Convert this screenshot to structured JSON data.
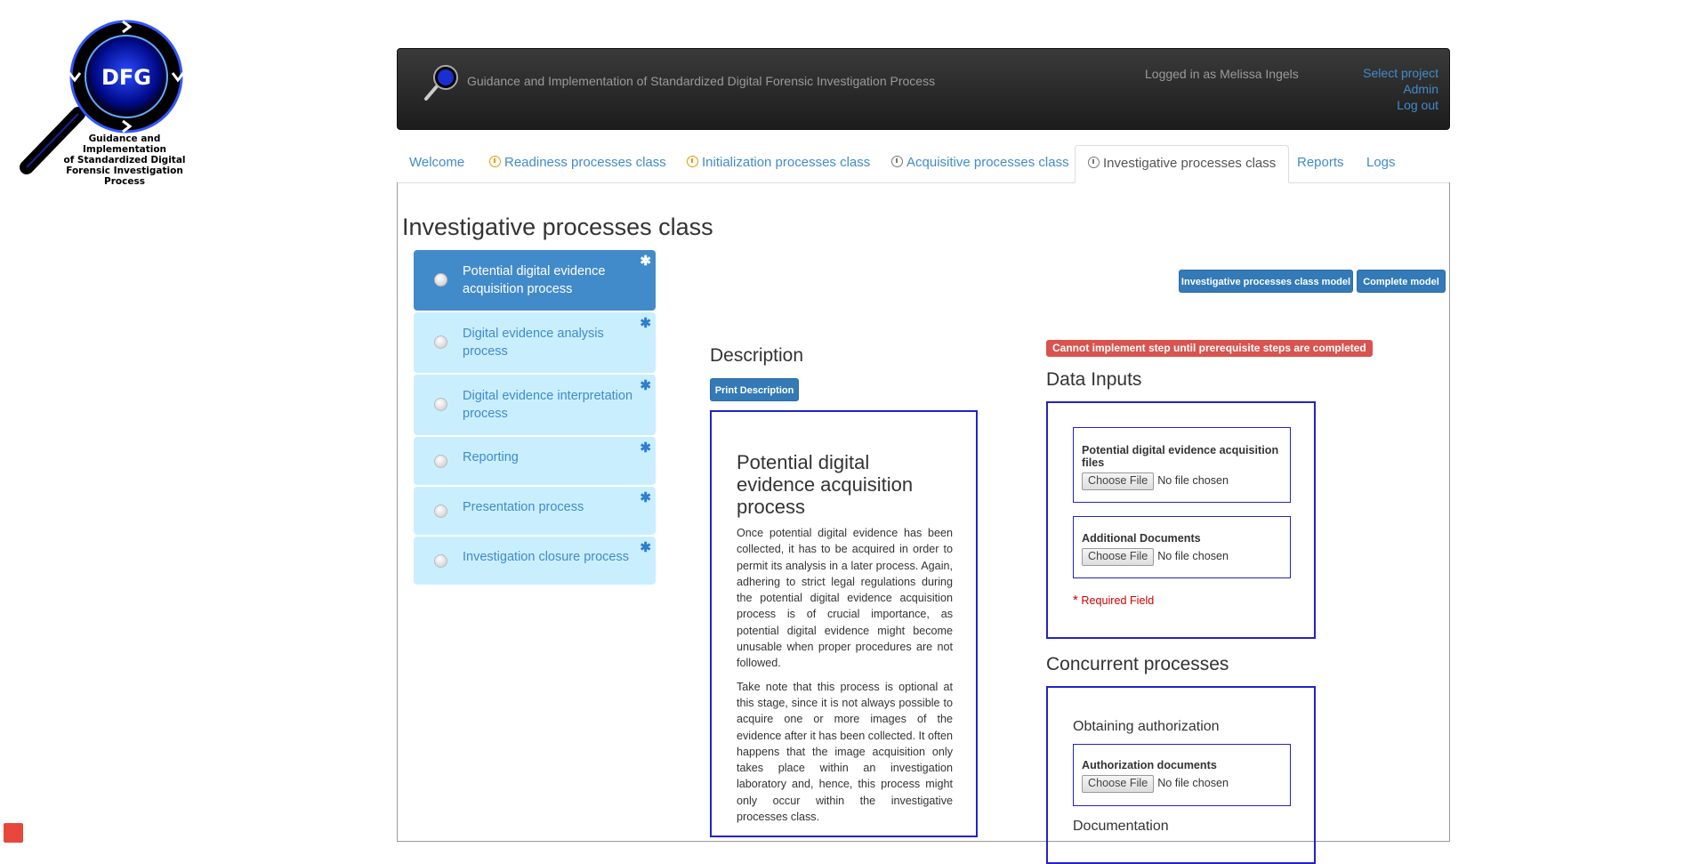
{
  "logo": {
    "badge": "DFG",
    "caption_lines": [
      "Guidance and",
      "Implementation",
      "of Standardized Digital",
      "Forensic Investigation Process"
    ]
  },
  "header": {
    "title": "Guidance and Implementation of Standardized Digital Forensic Investigation Process",
    "user": "Logged in as Melissa Ingels",
    "links": [
      "Select project",
      "Admin",
      "Log out"
    ]
  },
  "tabs": [
    {
      "label": "Welcome",
      "icon": ""
    },
    {
      "label": "Readiness processes class",
      "icon": "warning-circle-icon"
    },
    {
      "label": "Initialization processes class",
      "icon": "warning-circle-icon"
    },
    {
      "label": "Acquisitive processes class",
      "icon": "warning-circle-icon"
    },
    {
      "label": "Investigative processes class",
      "icon": "warning-circle-icon"
    },
    {
      "label": "Reports",
      "icon": ""
    },
    {
      "label": "Logs",
      "icon": ""
    }
  ],
  "page_title": "Investigative processes class",
  "sidebar": [
    {
      "label": "Potential digital evidence acquisition process",
      "star": "✱"
    },
    {
      "label": "Digital evidence analysis process",
      "star": "✱"
    },
    {
      "label": "Digital evidence interpretation process",
      "star": "✱"
    },
    {
      "label": "Reporting",
      "star": "✱"
    },
    {
      "label": "Presentation process",
      "star": "✱"
    },
    {
      "label": "Investigation closure process",
      "star": "✱"
    }
  ],
  "buttons": {
    "class_model": "Investigative processes class model",
    "complete_model": "Complete model",
    "print_description": "Print Description"
  },
  "description": {
    "heading": "Description",
    "title": "Potential digital evidence acquisition process",
    "paragraphs": [
      "Once potential digital evidence has been collected, it has to be acquired in order to permit its analysis in a later process. Again, adhering to strict legal regulations during the potential digital evidence acquisition process is of crucial importance, as potential digital evidence might become unusable when proper procedures are not followed.",
      "Take note that this process is optional at this stage, since it is not always possible to acquire one or more images of the evidence after it has been collected. It often happens that the image acquisition only takes place within an investigation laboratory and, hence, this process might only occur within the investigative processes class."
    ]
  },
  "alert": "Cannot implement step until prerequisite steps are completed",
  "data_inputs": {
    "heading": "Data Inputs",
    "fields": [
      {
        "label": "Potential digital evidence acquisition files",
        "button": "Choose File",
        "status": "No file chosen"
      },
      {
        "label": "Additional Documents",
        "button": "Choose File",
        "status": "No file chosen"
      }
    ],
    "required_star": "*",
    "required_label": "Required Field"
  },
  "concurrent": {
    "heading": "Concurrent processes",
    "sub1": "Obtaining authorization",
    "field": {
      "label": "Authorization documents",
      "button": "Choose File",
      "status": "No file chosen"
    },
    "sub2": "Documentation"
  }
}
